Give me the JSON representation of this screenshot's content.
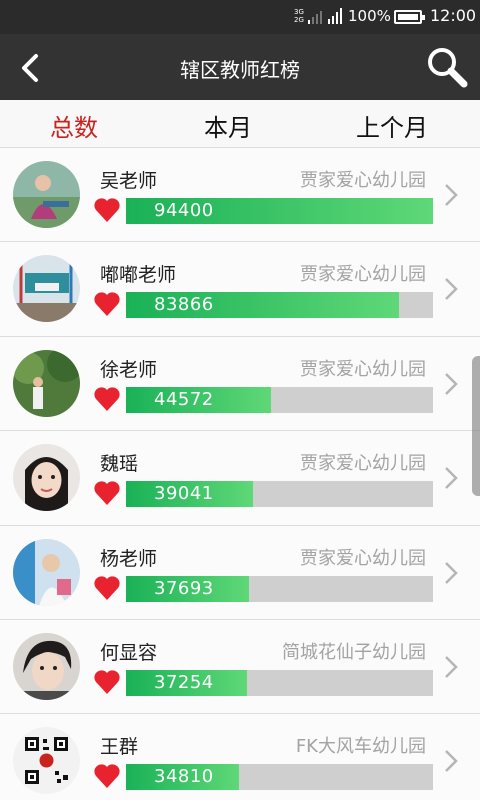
{
  "status_bar": {
    "network_top": "3G",
    "network_bottom": "2G",
    "battery": "100%",
    "time": "12:00"
  },
  "header": {
    "title": "辖区教师红榜",
    "back_icon": "chevron-left-icon",
    "search_icon": "search-icon"
  },
  "tabs": [
    {
      "label": "总数",
      "active": true
    },
    {
      "label": "本月",
      "active": false
    },
    {
      "label": "上个月",
      "active": false
    }
  ],
  "colors": {
    "header_bg": "#333333",
    "active_tab": "#c8231f",
    "bar_fill": "#1ab157",
    "bar_track": "#cfcfcf",
    "heart": "#e8232f"
  },
  "ranking": {
    "max_score": 94400,
    "items": [
      {
        "name": "吴老师",
        "school": "贾家爱心幼儿园",
        "score": "94400"
      },
      {
        "name": "嘟嘟老师",
        "school": "贾家爱心幼儿园",
        "score": "83866"
      },
      {
        "name": "徐老师",
        "school": "贾家爱心幼儿园",
        "score": "44572"
      },
      {
        "name": "魏瑶",
        "school": "贾家爱心幼儿园",
        "score": "39041"
      },
      {
        "name": "杨老师",
        "school": "贾家爱心幼儿园",
        "score": "37693"
      },
      {
        "name": "何显容",
        "school": "简城花仙子幼儿园",
        "score": "37254"
      },
      {
        "name": "王群",
        "school": "FK大风车幼儿园",
        "score": "34810"
      }
    ]
  }
}
